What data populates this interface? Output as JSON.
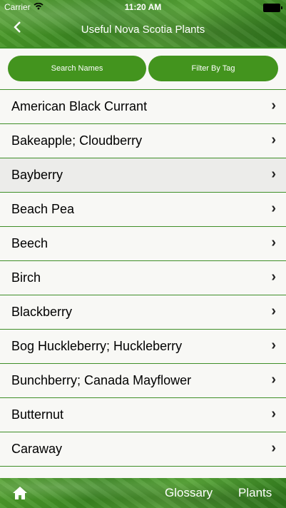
{
  "status_bar": {
    "carrier": "Carrier",
    "time": "11:20 AM"
  },
  "header": {
    "title": "Useful Nova Scotia Plants",
    "back_icon": "chevron-left-icon"
  },
  "toolbar": {
    "search_label": "Search Names",
    "filter_label": "Filter By Tag"
  },
  "plants": [
    {
      "name": "American Black Currant"
    },
    {
      "name": "Bakeapple; Cloudberry"
    },
    {
      "name": "Bayberry"
    },
    {
      "name": "Beach Pea"
    },
    {
      "name": "Beech"
    },
    {
      "name": "Birch"
    },
    {
      "name": "Blackberry"
    },
    {
      "name": "Bog Huckleberry; Huckleberry"
    },
    {
      "name": "Bunchberry; Canada Mayflower"
    },
    {
      "name": "Butternut"
    },
    {
      "name": "Caraway"
    },
    {
      "name": ""
    }
  ],
  "tabbar": {
    "home_icon": "home-icon",
    "glossary": "Glossary",
    "plants": "Plants"
  },
  "colors": {
    "accent": "#43941e",
    "divider": "#3f8f28",
    "row_highlight": "#ececea"
  }
}
